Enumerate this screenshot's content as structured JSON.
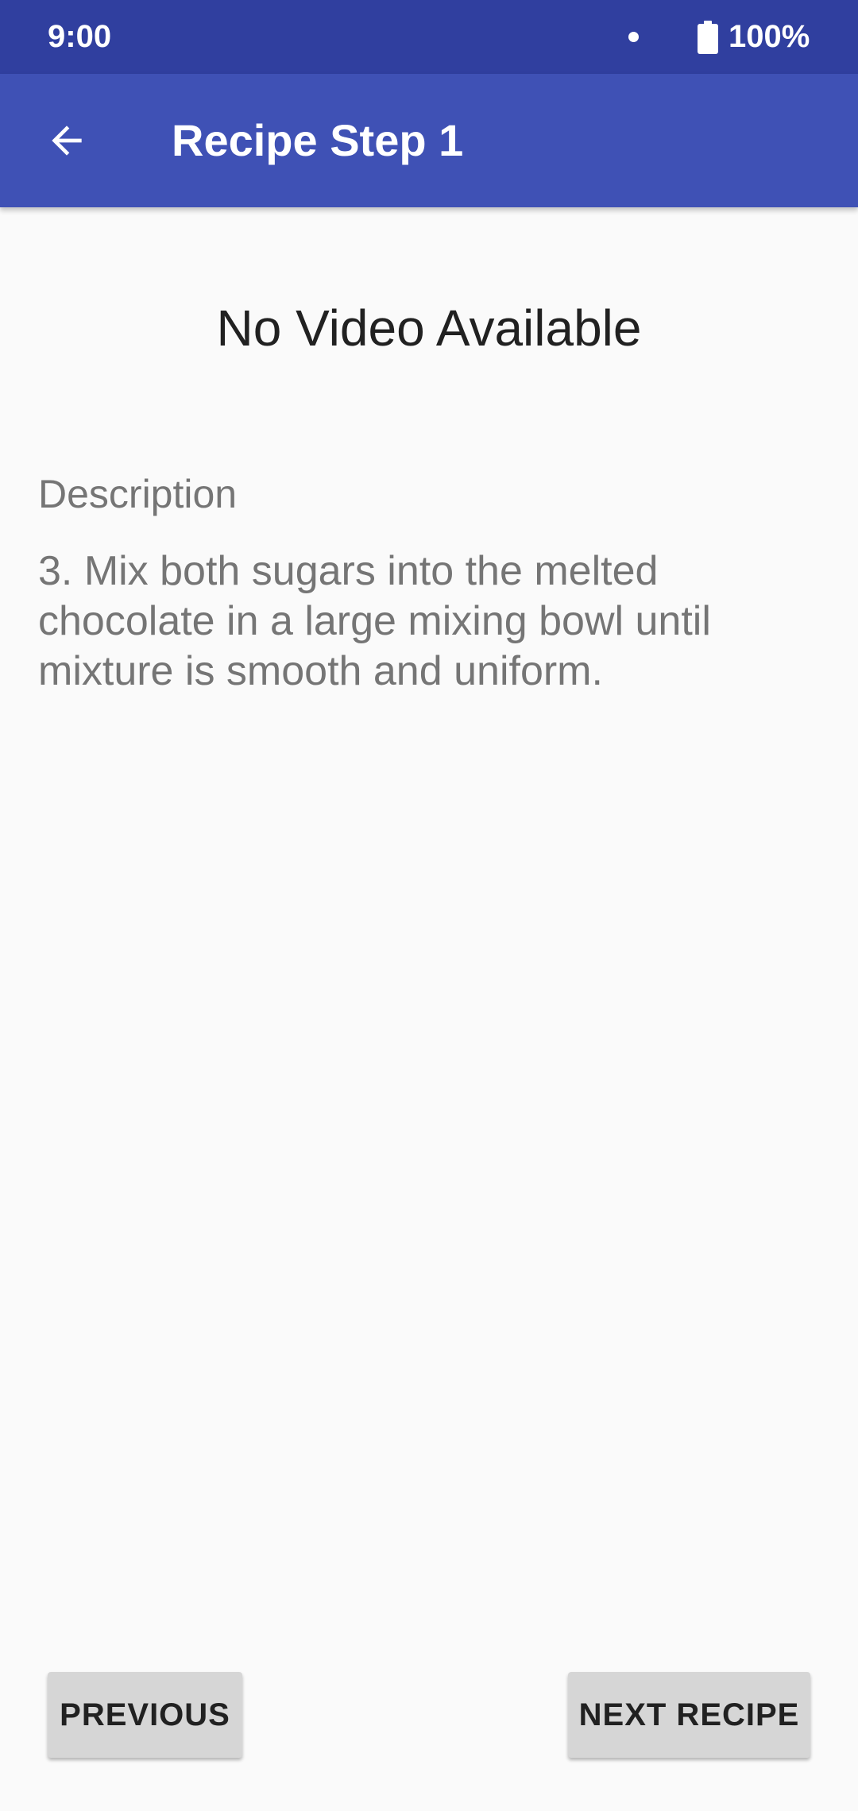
{
  "status_bar": {
    "time": "9:00",
    "battery_text": "100%"
  },
  "app_bar": {
    "title": "Recipe Step 1",
    "back_icon": "arrow-back-icon"
  },
  "content": {
    "no_video_text": "No Video Available",
    "description_label": "Description",
    "description_text": "3. Mix both sugars into the melted chocolate in a large mixing bowl until mixture is smooth and uniform."
  },
  "buttons": {
    "previous_label": "PREVIOUS",
    "next_label": "NEXT RECIPE"
  },
  "colors": {
    "status_bar": "#303f9f",
    "app_bar": "#3f51b5",
    "background": "#fafafa",
    "button": "#d6d6d6"
  }
}
